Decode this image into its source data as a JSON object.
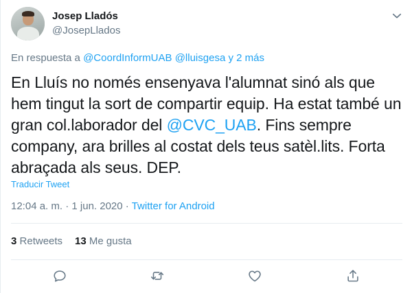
{
  "author": {
    "name": "Josep Lladós",
    "handle": "@JosepLlados"
  },
  "reply": {
    "prefix": "En respuesta a",
    "mention1": "@CoordInformUAB",
    "mention2": "@lluisgesa",
    "suffix": "y 2 más"
  },
  "tweet": {
    "text_part1": "En Lluís no només ensenyava l'alumnat sinó als que hem tingut la sort de compartir equip. Ha estat també un gran col.laborador del ",
    "mention": "@CVC_UAB",
    "text_part2": ". Fins sempre company, ara brilles al costat dels teus satèl.lits. Forta abraçada als seus. DEP."
  },
  "translate_label": "Traducir Tweet",
  "meta": {
    "time": "12:04 a. m.",
    "separator1": "·",
    "date": "1 jun. 2020",
    "separator2": "·",
    "source": "Twitter for Android"
  },
  "stats": {
    "retweets_count": "3",
    "retweets_label": "Retweets",
    "likes_count": "13",
    "likes_label": "Me gusta"
  },
  "icons": {
    "caret": "chevron-down-icon",
    "reply": "reply-icon",
    "retweet": "retweet-icon",
    "like": "heart-icon",
    "share": "share-icon"
  },
  "colors": {
    "accent": "#1da1f2",
    "text": "#14171a",
    "secondary": "#657786",
    "divider": "#e6ecf0"
  }
}
